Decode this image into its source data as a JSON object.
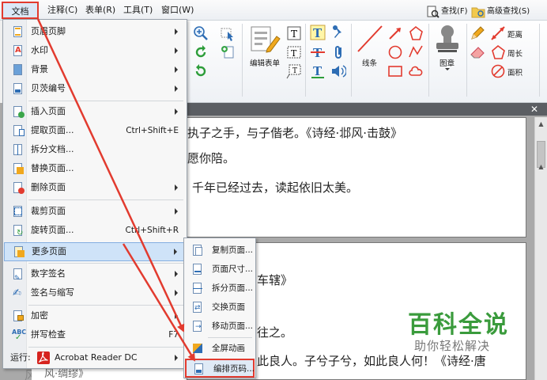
{
  "menubar": {
    "items": [
      "文档(D)",
      "注释(C)",
      "表单(R)",
      "工具(T)",
      "窗口(W)"
    ]
  },
  "ribbon": {
    "find": "查找(F)",
    "advanced_find": "高级查找(S)",
    "edit_form": "编辑表单",
    "line": "线条",
    "stamp": "图章",
    "distance": "距离",
    "perimeter": "周长",
    "area": "面积"
  },
  "menu": {
    "items": [
      {
        "label": "页眉页脚",
        "shortcut": "",
        "submenu": true
      },
      {
        "label": "水印",
        "shortcut": "",
        "submenu": true
      },
      {
        "label": "背景",
        "shortcut": "",
        "submenu": true
      },
      {
        "label": "贝茨编号",
        "shortcut": "",
        "submenu": true
      },
      {
        "label": "插入页面",
        "shortcut": "",
        "submenu": true
      },
      {
        "label": "提取页面...",
        "shortcut": "Ctrl+Shift+E",
        "submenu": false
      },
      {
        "label": "拆分文档...",
        "shortcut": "",
        "submenu": false
      },
      {
        "label": "替换页面...",
        "shortcut": "",
        "submenu": false
      },
      {
        "label": "删除页面",
        "shortcut": "",
        "submenu": true
      },
      {
        "label": "裁剪页面",
        "shortcut": "",
        "submenu": true
      },
      {
        "label": "旋转页面...",
        "shortcut": "Ctrl+Shift+R",
        "submenu": false
      },
      {
        "label": "更多页面",
        "shortcut": "",
        "submenu": true
      },
      {
        "label": "数字签名",
        "shortcut": "",
        "submenu": true
      },
      {
        "label": "签名与缩写",
        "shortcut": "",
        "submenu": true
      },
      {
        "label": "加密",
        "shortcut": "",
        "submenu": true
      },
      {
        "label": "拼写检查",
        "shortcut": "F7",
        "submenu": false
      },
      {
        "label": "运行:",
        "shortcut": "",
        "submenu": true,
        "app": "Acrobat Reader DC"
      }
    ]
  },
  "submenu": {
    "items": [
      "复制页面...",
      "页面尺寸...",
      "拆分页面...",
      "交换页面",
      "移动页面...",
      "全屏动画",
      "编排页码..."
    ]
  },
  "document": {
    "page1_lines": [
      "执子之手，与子偕老。《诗经·邶风·击鼓》",
      "愿你陪。",
      "千年已经过去，读起依旧太美。"
    ],
    "page2_lines": [
      "车辖》",
      "往之。",
      "此良人。子兮子兮，如此良人何！《诗经·唐",
      "风·绸缪》"
    ]
  },
  "watermark": {
    "title": "百科全说",
    "subtitle": "助你轻松解决"
  },
  "colors": {
    "highlight_border": "#e23b2f",
    "menu_highlight": "#cfe3f8",
    "watermark_green": "#3a9b3c"
  }
}
